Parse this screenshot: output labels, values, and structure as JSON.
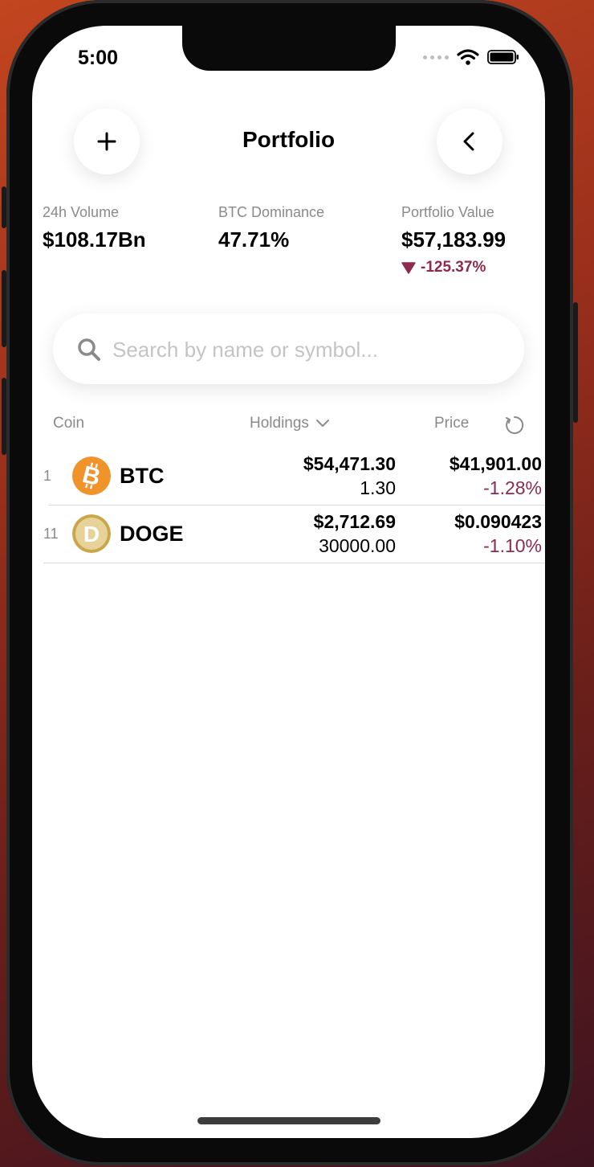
{
  "status_bar": {
    "time": "5:00"
  },
  "header": {
    "title": "Portfolio",
    "add_icon": "plus-icon",
    "back_icon": "chevron-left-icon"
  },
  "stats": [
    {
      "label": "24h Volume",
      "value": "$108.17Bn"
    },
    {
      "label": "BTC Dominance",
      "value": "47.71%"
    },
    {
      "label": "Portfolio Value",
      "value": "$57,183.99",
      "change": "-125.37%"
    }
  ],
  "search": {
    "placeholder": "Search by name or symbol...",
    "value": ""
  },
  "columns": {
    "coin": "Coin",
    "holdings": "Holdings",
    "price": "Price"
  },
  "coins": [
    {
      "rank": "1",
      "symbol": "BTC",
      "holdings_value": "$54,471.30",
      "holdings_amount": "1.30",
      "price": "$41,901.00",
      "change": "-1.28%"
    },
    {
      "rank": "11",
      "symbol": "DOGE",
      "holdings_value": "$2,712.69",
      "holdings_amount": "30000.00",
      "price": "$0.090423",
      "change": "-1.10%"
    }
  ],
  "colors": {
    "negative": "#8e2a4f",
    "btc": "#f0932b",
    "doge": "#c9a74a",
    "secondary_text": "#8a8a8a"
  }
}
